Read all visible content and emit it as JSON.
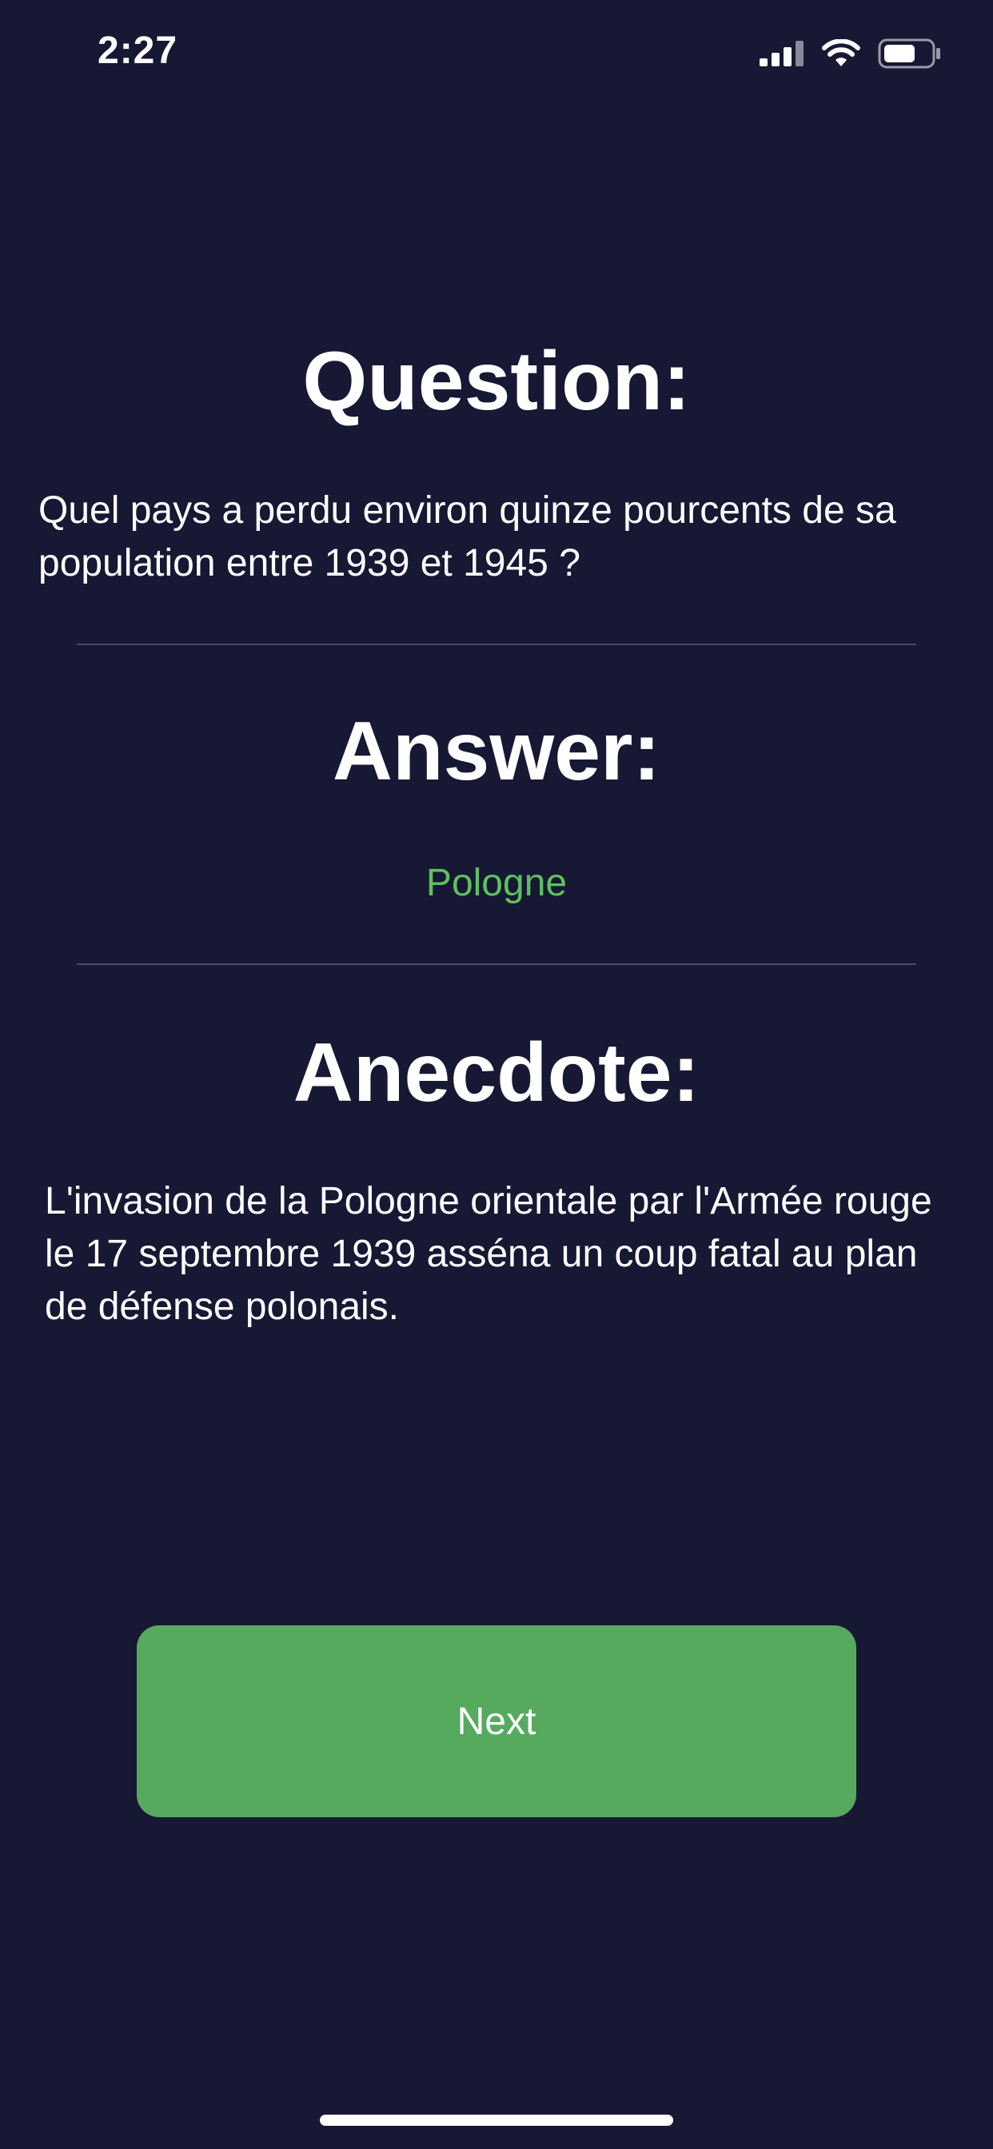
{
  "status_bar": {
    "time": "2:27",
    "icons": [
      "cellular-signal-icon",
      "wifi-icon",
      "battery-icon"
    ]
  },
  "question": {
    "heading": "Question:",
    "text": "Quel pays a perdu environ quinze pourcents de sa population entre 1939 et 1945 ?"
  },
  "answer": {
    "heading": "Answer:",
    "text": "Pologne"
  },
  "anecdote": {
    "heading": "Anecdote:",
    "text": "L'invasion de la Pologne orientale par l'Armée rouge le 17 septembre 1939 asséna un coup fatal au plan de défense polonais."
  },
  "actions": {
    "next_label": "Next"
  },
  "colors": {
    "background": "#171834",
    "answer": "#5ec05f",
    "button": "#56aa5e",
    "text": "#ffffff"
  }
}
